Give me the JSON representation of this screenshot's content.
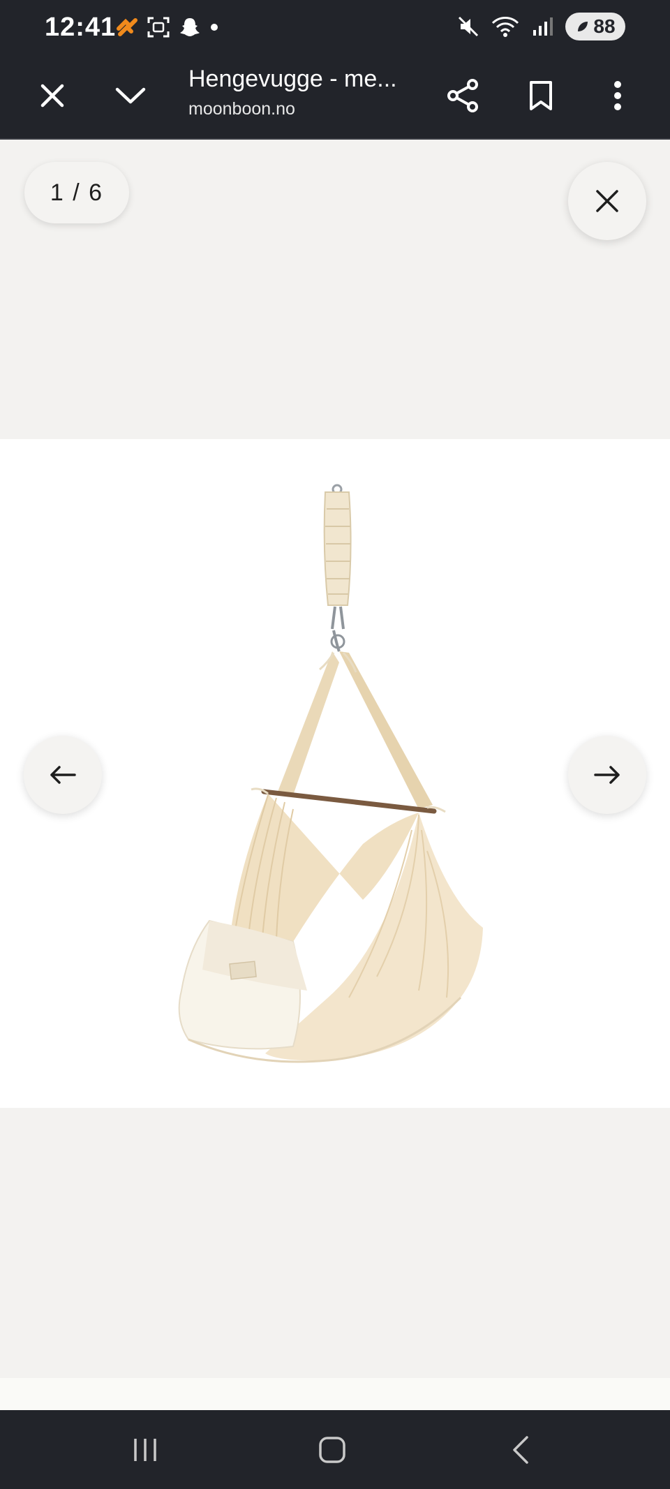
{
  "status_bar": {
    "time": "12:41",
    "battery": "88",
    "icons": [
      "orange-app-icon",
      "screenshot-icon",
      "snapchat-icon",
      "dot-icon",
      "mute-icon",
      "wifi-icon",
      "signal-icon",
      "battery-icon"
    ]
  },
  "toolbar": {
    "title": "Hengevugge - me...",
    "url": "moonboon.no",
    "icons": [
      "close-icon",
      "chevron-down-icon",
      "share-icon",
      "bookmark-icon",
      "more-vert-icon"
    ]
  },
  "gallery": {
    "counter": "1 / 6",
    "image_alt": "Hanging baby hammock cradle in natural cream fabric",
    "icons": [
      "close-icon",
      "arrow-left-icon",
      "arrow-right-icon"
    ]
  },
  "nav_bar": {
    "icons": [
      "recents-icon",
      "home-icon",
      "back-icon"
    ]
  },
  "colors": {
    "chrome": "#22242a",
    "viewer_bg": "#f3f2f0",
    "fabric": "#f1e6d2",
    "accent_orange": "#f08a1c"
  }
}
